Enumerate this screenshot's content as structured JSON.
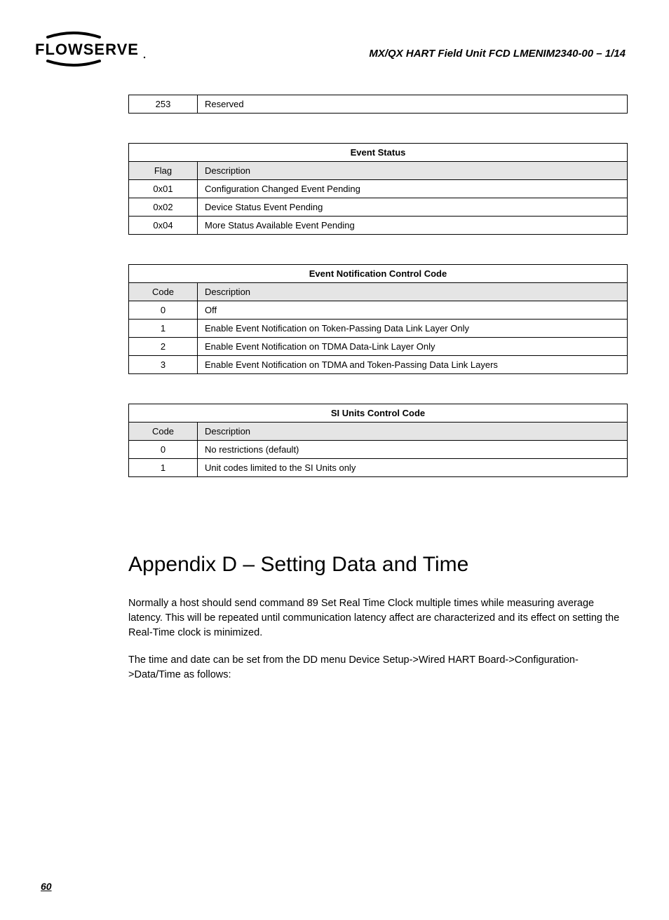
{
  "header": {
    "doc_title": "MX/QX HART Field Unit   FCD LMENIM2340-00 – 1/14",
    "logo_text": "FLOWSERVE"
  },
  "reserved_table": {
    "rows": [
      {
        "code": "253",
        "desc": "Reserved"
      }
    ]
  },
  "event_status_table": {
    "title": "Event Status",
    "col1_header": "Flag",
    "col2_header": "Description",
    "rows": [
      {
        "code": "0x01",
        "desc": "Configuration Changed Event Pending"
      },
      {
        "code": "0x02",
        "desc": "Device Status Event Pending"
      },
      {
        "code": "0x04",
        "desc": "More Status Available Event Pending"
      }
    ]
  },
  "event_notification_table": {
    "title": "Event Notification Control Code",
    "col1_header": "Code",
    "col2_header": "Description",
    "rows": [
      {
        "code": "0",
        "desc": "Off"
      },
      {
        "code": "1",
        "desc": "Enable Event Notification on Token-Passing Data Link Layer Only"
      },
      {
        "code": "2",
        "desc": "Enable Event Notification on TDMA Data-Link Layer Only"
      },
      {
        "code": "3",
        "desc": "Enable Event Notification on TDMA and Token-Passing Data Link Layers"
      }
    ]
  },
  "si_units_table": {
    "title": "SI Units Control Code",
    "col1_header": "Code",
    "col2_header": "Description",
    "rows": [
      {
        "code": "0",
        "desc": "No restrictions (default)"
      },
      {
        "code": "1",
        "desc": "Unit codes limited to the SI Units only"
      }
    ]
  },
  "appendix": {
    "title": "Appendix D – Setting Data and Time",
    "para1": "Normally a host should send command 89 Set Real Time Clock multiple times while measuring average latency. This will be repeated until communication latency affect are characterized and its effect on setting the Real-Time clock is minimized.",
    "para2": "The time and date can be set from the DD menu Device Setup->Wired HART Board->Configuration->Data/Time as follows:"
  },
  "page_number": "60"
}
